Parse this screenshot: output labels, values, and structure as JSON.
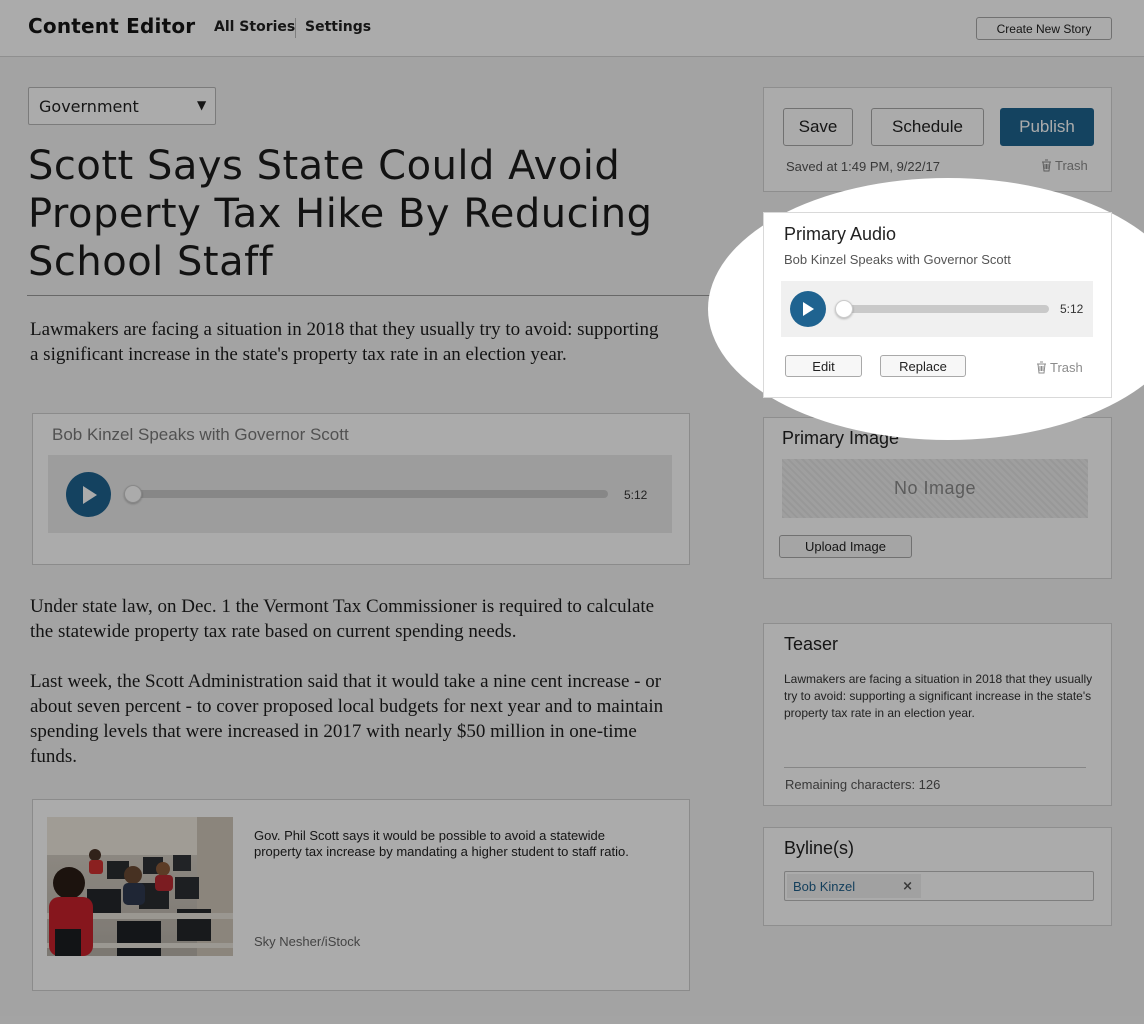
{
  "header": {
    "app_title": "Content Editor",
    "nav": [
      {
        "label": "All Stories"
      },
      {
        "label": "Settings"
      }
    ],
    "create_button": "Create New Story"
  },
  "editor": {
    "category": "Government",
    "headline": "Scott Says State Could Avoid Property Tax Hike By Reducing School Staff",
    "paragraphs": [
      "Lawmakers are facing a situation in 2018 that they usually try to avoid: supporting a significant increase in the state's property tax rate in an election year.",
      "Under state law, on Dec. 1 the Vermont Tax Commissioner is required to calculate the statewide property tax rate based on current spending needs.",
      "Last week, the Scott Administration said that it would take a nine cent increase - or about seven percent - to cover proposed local budgets for next year and to maintain spending levels that were increased in 2017 with nearly $50 million in one-time funds."
    ],
    "audio_embed": {
      "title": "Bob Kinzel Speaks with Governor Scott",
      "duration": "5:12",
      "progress": 0
    },
    "image_embed": {
      "caption": "Gov. Phil Scott says it would be possible to avoid a statewide property tax increase by mandating a higher student to staff ratio.",
      "credit": "Sky Nesher/iStock"
    }
  },
  "sidebar": {
    "actions": {
      "save": "Save",
      "schedule": "Schedule",
      "publish": "Publish"
    },
    "saved_at": "Saved at 1:49 PM, 9/22/17",
    "trash": "Trash",
    "primary_audio": {
      "title": "Primary Audio",
      "subtitle": "Bob Kinzel Speaks with Governor Scott",
      "duration": "5:12",
      "progress": 0,
      "edit": "Edit",
      "replace": "Replace",
      "trash": "Trash"
    },
    "primary_image": {
      "title": "Primary Image",
      "placeholder": "No Image",
      "upload": "Upload Image"
    },
    "teaser": {
      "title": "Teaser",
      "text": "Lawmakers are facing a situation in 2018 that they usually try to avoid: supporting a significant increase in the state's property tax rate in an election year.",
      "remaining": "Remaining characters: 126"
    },
    "byline": {
      "title": "Byline(s)",
      "authors": [
        {
          "name": "Bob Kinzel",
          "remove": "×"
        }
      ]
    }
  },
  "colors": {
    "accent": "#1f6590",
    "play_button": "#1f6390",
    "dim_overlay": "rgba(0,0,0,0.33)"
  }
}
